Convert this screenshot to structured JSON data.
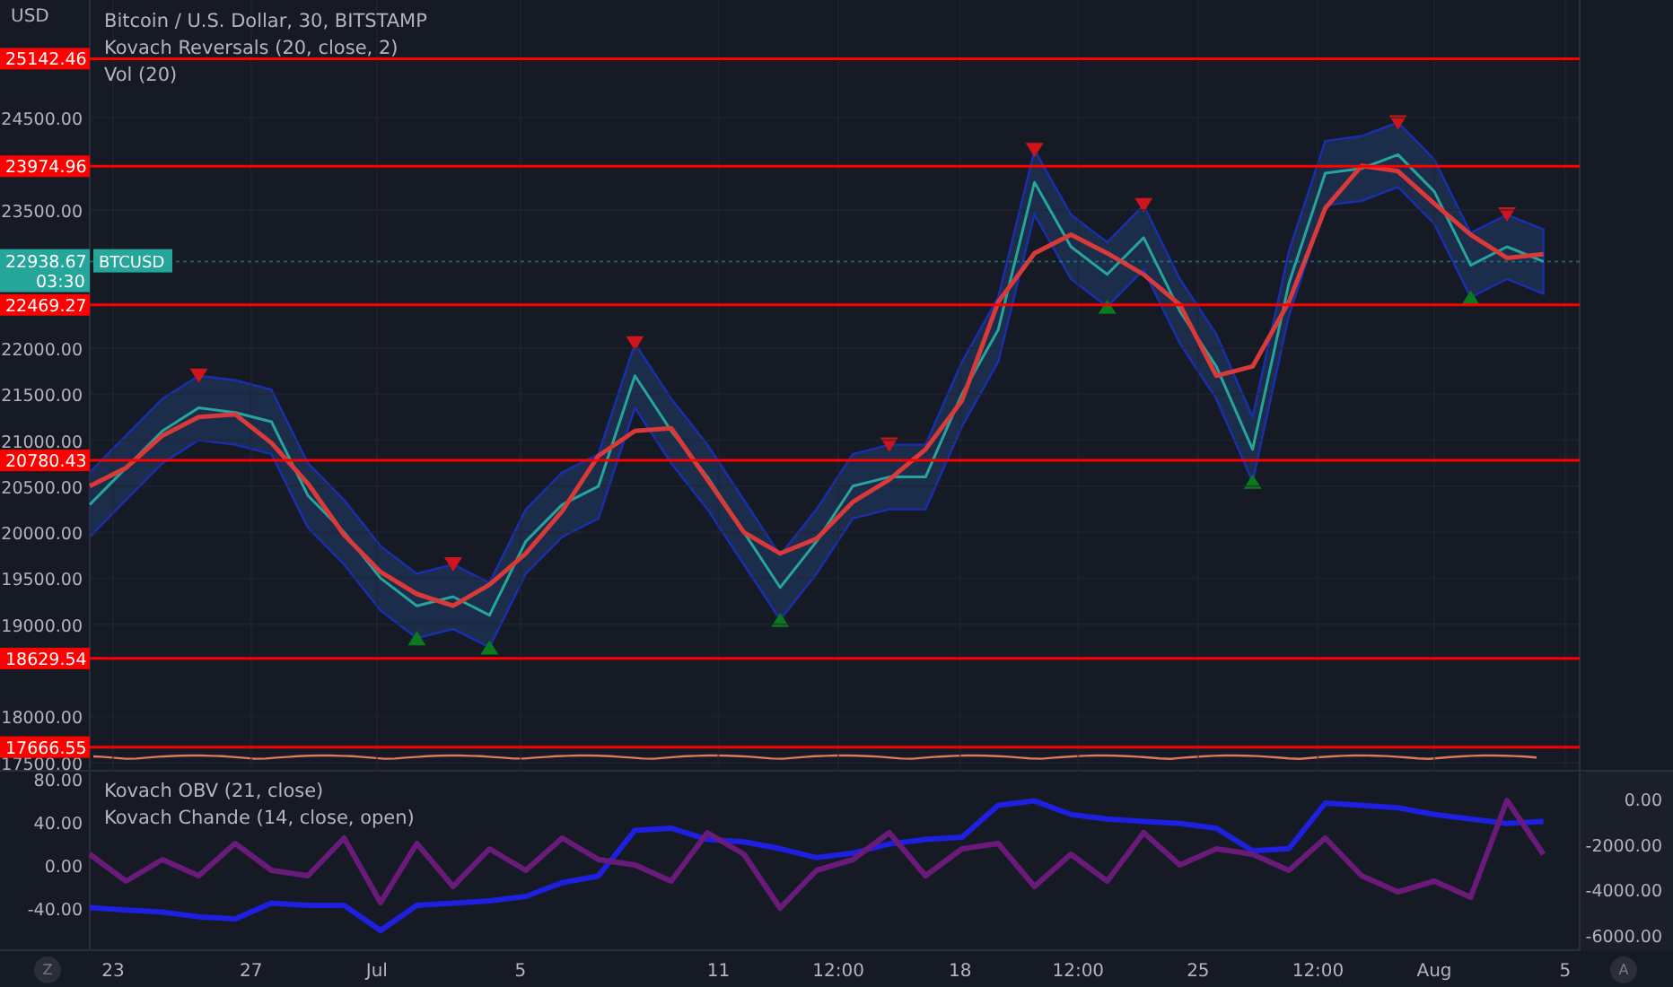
{
  "price_pane": {
    "unit": "USD",
    "title": "Bitcoin / U.S. Dollar, 30, BITSTAMP",
    "indicator_params": "(20, close, 2)",
    "volume_label": "Vol (20)",
    "current_price": {
      "price": "22938.67",
      "countdown": "03:30"
    },
    "chart_data": {
      "type": "line",
      "grid": true,
      "ylim": [
        17400,
        25780
      ],
      "yticks": [
        {
          "value": 24500,
          "label": "24500.00"
        },
        {
          "value": 23500,
          "label": "23500.00"
        },
        {
          "value": 22000,
          "label": "22000.00"
        },
        {
          "value": 21500,
          "label": "21500.00"
        },
        {
          "value": 21000,
          "label": "21000.00"
        },
        {
          "value": 20500,
          "label": "20500.00"
        },
        {
          "value": 20000,
          "label": "20000.00"
        },
        {
          "value": 19500,
          "label": "19500.00"
        },
        {
          "value": 19000,
          "label": "19000.00"
        },
        {
          "value": 18000,
          "label": "18000.00"
        },
        {
          "value": 17500,
          "label": "17500.00"
        }
      ],
      "series": [
        {
          "name": "BTCUSD",
          "color": "#26a69a",
          "values": [
            20300,
            20700,
            21100,
            21350,
            21300,
            21200,
            20400,
            20000,
            19500,
            19200,
            19300,
            19100,
            19900,
            20300,
            20500,
            21700,
            21100,
            20600,
            20000,
            19400,
            19900,
            20500,
            20600,
            20600,
            21500,
            22200,
            23800,
            23100,
            22800,
            23200,
            22400,
            21800,
            20900,
            22700,
            23900,
            23950,
            24100,
            23700,
            22900,
            23100,
            22940
          ]
        },
        {
          "name": "Kovach Reversals",
          "color": "#d83a3a",
          "values": [
            20500,
            20700,
            21050,
            21250,
            21280,
            20970,
            20530,
            19970,
            19570,
            19330,
            19200,
            19430,
            19770,
            20230,
            20830,
            21100,
            21130,
            20570,
            20000,
            19770,
            19930,
            20330,
            20570,
            20900,
            21430,
            22500,
            23030,
            23230,
            23030,
            22800,
            22470,
            21700,
            21800,
            22500,
            23520,
            23980,
            23920,
            23570,
            23230,
            22980,
            23020
          ]
        }
      ]
    },
    "levels": [
      "25142.46",
      "23974.96",
      "22469.27",
      "20780.43",
      "18629.54",
      "17666.55"
    ]
  },
  "indicator_pane": {
    "legend_params": [
      "(21, close)",
      "(14, close, open)"
    ],
    "chart_data": {
      "type": "line",
      "ylim": [
        -80,
        86.7
      ],
      "y2lim": [
        -6711,
        1184
      ],
      "yticks": [
        {
          "value": 80,
          "label": "80.00"
        },
        {
          "value": 40,
          "label": "40.00"
        },
        {
          "value": 0,
          "label": "0.00"
        },
        {
          "value": -40,
          "label": "-40.00"
        }
      ],
      "y2ticks": [
        {
          "value": 0,
          "label": "0.00"
        },
        {
          "value": -2000,
          "label": "-2000.00"
        },
        {
          "value": -4000,
          "label": "-4000.00"
        },
        {
          "value": -6000,
          "label": "-6000.00"
        }
      ],
      "series": [
        {
          "name": "Kovach OBV",
          "color": "#1f1fe0",
          "axis": "y2",
          "values": [
            -4800,
            -4900,
            -5000,
            -5200,
            -5300,
            -4600,
            -4700,
            -4700,
            -5800,
            -4700,
            -4600,
            -4500,
            -4300,
            -3700,
            -3400,
            -1400,
            -1300,
            -1800,
            -1900,
            -2200,
            -2600,
            -2400,
            -2000,
            -1800,
            -1700,
            -300,
            -100,
            -700,
            -900,
            -1000,
            -1100,
            -1300,
            -2300,
            -2200,
            -200,
            -300,
            -400,
            -700,
            -900,
            -1100,
            -1000
          ]
        },
        {
          "name": "Kovach Chande",
          "color": "#6a1b7a",
          "values": [
            10,
            -15,
            5,
            -10,
            20,
            -5,
            -10,
            25,
            -35,
            20,
            -20,
            15,
            -5,
            25,
            5,
            0,
            -15,
            30,
            10,
            -40,
            -5,
            5,
            30,
            -10,
            15,
            20,
            -20,
            10,
            -15,
            30,
            0,
            15,
            10,
            -5,
            25,
            -10,
            -25,
            -15,
            -30,
            60,
            10
          ]
        }
      ]
    }
  },
  "time_axis": {
    "labels": [
      "23",
      "27",
      "Jul",
      "5",
      "11",
      "12:00",
      "18",
      "12:00",
      "25",
      "12:00",
      "Aug",
      "5"
    ]
  },
  "corner_buttons": [
    "Z",
    "A"
  ]
}
